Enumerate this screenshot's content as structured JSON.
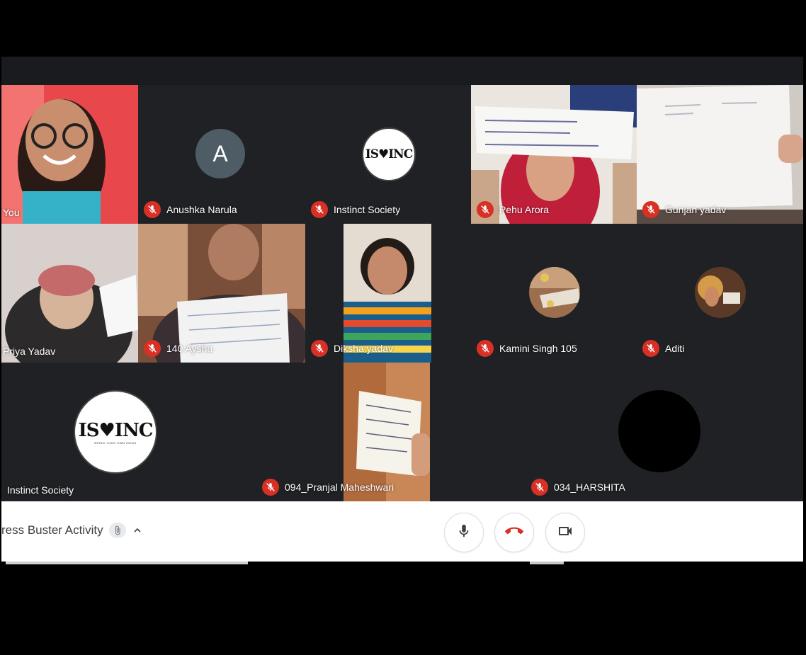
{
  "meeting": {
    "title": "ress Buster Activity",
    "controls": {
      "mic": "mic-icon",
      "hangup": "hangup-icon",
      "camera": "camera-icon"
    }
  },
  "colors": {
    "mute": "#d93025",
    "grid_bg": "#202124",
    "tile_bg": "#3c4043",
    "speaking": "#3fe0c8"
  },
  "participants": [
    {
      "name": "You",
      "muted": false
    },
    {
      "name": "Anushka Narula",
      "muted": true,
      "avatar_letter": "A"
    },
    {
      "name": "Instinct Society",
      "muted": true,
      "logo_text": "IS♥INC"
    },
    {
      "name": "Pehu Arora",
      "muted": true
    },
    {
      "name": "Gunjan yadav",
      "muted": true
    },
    {
      "name": "Priya Yadav",
      "muted": false
    },
    {
      "name": "140 Aysha",
      "muted": true
    },
    {
      "name": "Diksha yadav",
      "muted": true
    },
    {
      "name": "Kamini Singh 105",
      "muted": true
    },
    {
      "name": "Aditi",
      "muted": true
    },
    {
      "name": "Instinct Society",
      "muted": false,
      "logo_text": "IS♥INC",
      "logo_tagline": "BRING YOUR OWN IDEAS"
    },
    {
      "name": "094_Pranjal Maheshwari",
      "muted": true
    },
    {
      "name": "034_HARSHITA",
      "muted": true
    }
  ]
}
